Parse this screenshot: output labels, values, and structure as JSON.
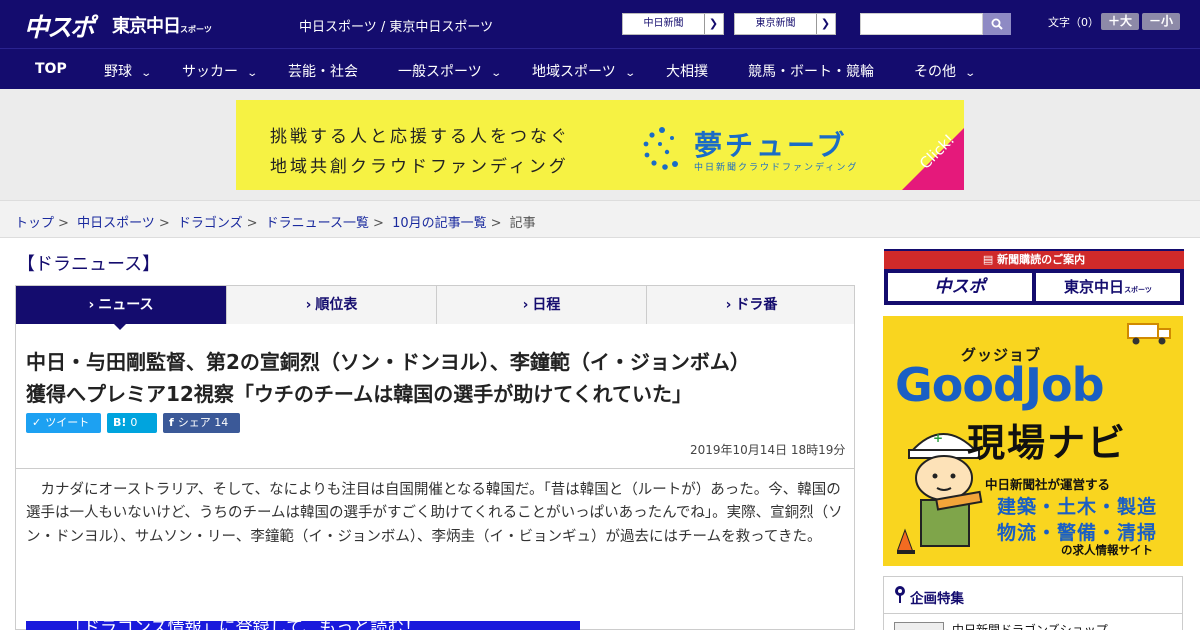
{
  "header": {
    "logo_chuspo": "中スポ",
    "logo_tokyo": "東京中日",
    "logo_tokyo_suffix": "スポーツ",
    "site_links": "中日スポーツ / 東京中日スポーツ",
    "paper_buttons": [
      {
        "label": "中日新聞"
      },
      {
        "label": "東京新聞"
      }
    ],
    "search": {
      "placeholder": ""
    },
    "font_size_label": "文字（0）",
    "font_bigger": "＋大",
    "font_smaller": "－小"
  },
  "nav": {
    "items": [
      {
        "label": "TOP",
        "has_menu": false
      },
      {
        "label": "野球",
        "has_menu": true
      },
      {
        "label": "サッカー",
        "has_menu": true
      },
      {
        "label": "芸能・社会",
        "has_menu": false
      },
      {
        "label": "一般スポーツ",
        "has_menu": true
      },
      {
        "label": "地域スポーツ",
        "has_menu": true
      },
      {
        "label": "大相撲",
        "has_menu": false
      },
      {
        "label": "競馬・ボート・競輪",
        "has_menu": false
      },
      {
        "label": "その他",
        "has_menu": true
      }
    ]
  },
  "banner": {
    "line1": "挑戦する人と応援する人をつなぐ",
    "line2": "地域共創クラウドファンディング",
    "brand": "夢チューブ",
    "brand_sub": "中日新聞クラウドファンディング",
    "click": "Click!"
  },
  "breadcrumb": {
    "links": [
      "トップ",
      "中日スポーツ",
      "ドラゴンズ",
      "ドラニュース一覧",
      "10月の記事一覧"
    ],
    "current": "記事"
  },
  "section_title": "【ドラニュース】",
  "tabs": [
    {
      "label": "ニュース",
      "active": true
    },
    {
      "label": "順位表",
      "active": false
    },
    {
      "label": "日程",
      "active": false
    },
    {
      "label": "ドラ番",
      "active": false
    }
  ],
  "article": {
    "headline_line1": "中日・与田剛監督、第2の宣銅烈（ソン・ドンヨル）、李鐘範（イ・ジョンボム）",
    "headline_line2": "獲得へプレミア12視察「ウチのチームは韓国の選手が助けてくれていた」",
    "share": {
      "tweet_label": "ツイート",
      "hatena_label": "B!",
      "hatena_count": "0",
      "fb_label": "シェア",
      "fb_count": "14"
    },
    "date": "2019年10月14日 18時19分",
    "body": "カナダにオーストラリア、そして、なによりも注目は自国開催となる韓国だ。「昔は韓国と（ルートが）あった。今、韓国の選手は一人もいないけど、うちのチームは韓国の選手がすごく助けてくれることがいっぱいあったんでね」。実際、宣銅烈（ソン・ドンヨル）、サムソン・リー、李鐘範（イ・ジョンボム）、李炳圭（イ・ビョンギュ）が過去にはチームを救ってきた。",
    "promo": "「ドラゴンズ情報」に登録して、もっと読む！"
  },
  "sidebar": {
    "subscribe": {
      "head": "新聞購読のご案内",
      "btn1": "中スポ",
      "btn2": "東京中日",
      "btn2_suffix": "スポーツ"
    },
    "goodjob": {
      "kana": "グッジョブ",
      "title": "GoodJob",
      "subtitle": "現場ナビ",
      "operator": "中日新聞社が運営する",
      "line1": "建築・土木・製造",
      "line2": "物流・警備・清掃",
      "site": "の求人情報サイト"
    },
    "kikaku": {
      "title": "企画特集",
      "first_item": "中日新聞ドラゴンズショップ"
    }
  },
  "colors": {
    "brand_navy": "#140c6e",
    "banner_yellow": "#f6f243",
    "twitter": "#1da1f2",
    "hatena": "#00a4de",
    "facebook": "#3b5998"
  }
}
